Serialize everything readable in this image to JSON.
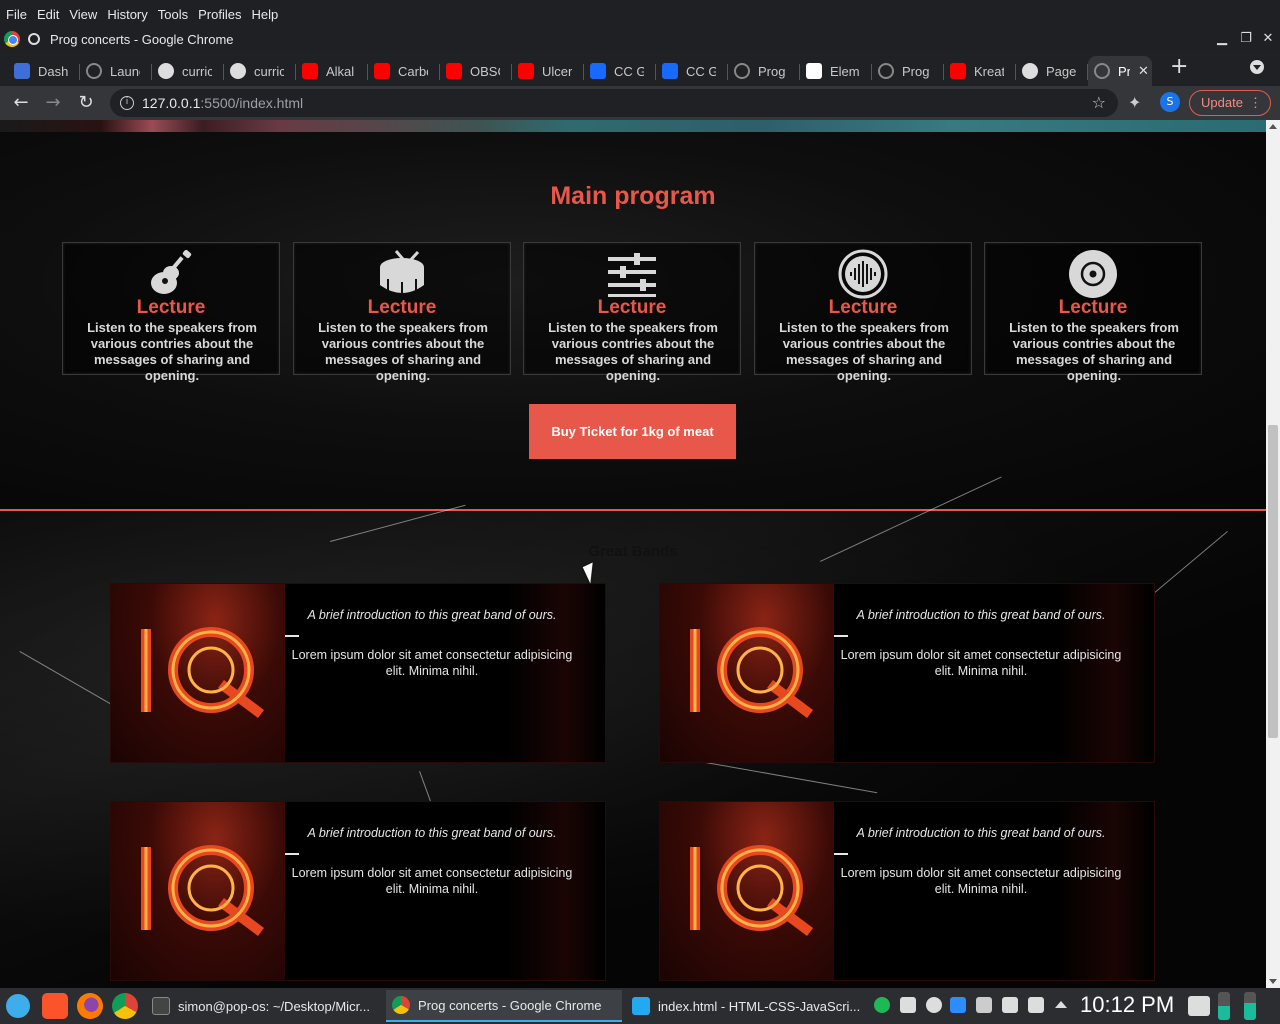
{
  "menubar": {
    "items": [
      "File",
      "Edit",
      "View",
      "History",
      "Tools",
      "Profiles",
      "Help"
    ]
  },
  "window": {
    "title": "Prog concerts - Google Chrome"
  },
  "tabs": [
    {
      "label": "Dashb",
      "icon": "dashboard-icon",
      "color": "#3f6fd6"
    },
    {
      "label": "Launc",
      "icon": "globe-icon",
      "color": "#888888"
    },
    {
      "label": "curric",
      "icon": "github-icon",
      "color": "#dddddd"
    },
    {
      "label": "curric",
      "icon": "github-icon",
      "color": "#dddddd"
    },
    {
      "label": "Alkal",
      "icon": "youtube-icon",
      "color": "#ff0000"
    },
    {
      "label": "Carbo",
      "icon": "youtube-icon",
      "color": "#ff0000"
    },
    {
      "label": "OBSC",
      "icon": "youtube-icon",
      "color": "#ff0000"
    },
    {
      "label": "Ulcer",
      "icon": "youtube-icon",
      "color": "#ff0000"
    },
    {
      "label": "CC Gl",
      "icon": "behance-icon",
      "color": "#1769ff"
    },
    {
      "label": "CC Gl",
      "icon": "behance-icon",
      "color": "#1769ff"
    },
    {
      "label": "Prog",
      "icon": "globe-icon",
      "color": "#888888"
    },
    {
      "label": "Elem",
      "icon": "elementor-icon",
      "color": "#ffffff"
    },
    {
      "label": "Prog",
      "icon": "globe-icon",
      "color": "#888888"
    },
    {
      "label": "Kreat",
      "icon": "youtube-icon",
      "color": "#ff0000"
    },
    {
      "label": "Page",
      "icon": "github-icon",
      "color": "#dddddd"
    },
    {
      "label": "Pr",
      "icon": "globe-icon",
      "color": "#888888",
      "active": true
    }
  ],
  "address": {
    "host": "127.0.0.1",
    "path": ":5500/index.html"
  },
  "profile_initial": "S",
  "update_label": "Update",
  "page": {
    "program_title": "Main program",
    "cards": [
      {
        "icon": "guitar-icon",
        "title": "Lecture",
        "text": "Listen to the speakers from various contries about the messages of sharing and opening."
      },
      {
        "icon": "drum-icon",
        "title": "Lecture",
        "text": "Listen to the speakers from various contries about the messages of sharing and opening."
      },
      {
        "icon": "sliders-icon",
        "title": "Lecture",
        "text": "Listen to the speakers from various contries about the messages of sharing and opening."
      },
      {
        "icon": "soundwave-icon",
        "title": "Lecture",
        "text": "Listen to the speakers from various contries about the messages of sharing and opening."
      },
      {
        "icon": "vinyl-icon",
        "title": "Lecture",
        "text": "Listen to the speakers from various contries about the messages of sharing and opening."
      }
    ],
    "buy_label": "Buy Ticket for 1kg of meat",
    "bands_title": "Great Bands",
    "bands": [
      {
        "logo": "IQ",
        "intro": "A brief introduction to this great band of ours.",
        "text": "Lorem ipsum dolor sit amet consectetur adipisicing elit. Minima nihil."
      },
      {
        "logo": "IQ",
        "intro": "A brief introduction to this great band of ours.",
        "text": "Lorem ipsum dolor sit amet consectetur adipisicing elit. Minima nihil."
      },
      {
        "logo": "IQ",
        "intro": "A brief introduction to this great band of ours.",
        "text": "Lorem ipsum dolor sit amet consectetur adipisicing elit. Minima nihil."
      },
      {
        "logo": "IQ",
        "intro": "A brief introduction to this great band of ours.",
        "text": "Lorem ipsum dolor sit amet consectetur adipisicing elit. Minima nihil."
      }
    ],
    "accent": "#e8584a"
  },
  "taskbar": {
    "tasks": [
      {
        "label": "simon@pop-os: ~/Desktop/Micr...",
        "icon": "terminal-icon"
      },
      {
        "label": "Prog concerts - Google Chrome",
        "icon": "chrome-icon",
        "active": true
      },
      {
        "label": "index.html - HTML-CSS-JavaScri...",
        "icon": "vscode-icon"
      }
    ],
    "clock": "10:12 PM"
  }
}
